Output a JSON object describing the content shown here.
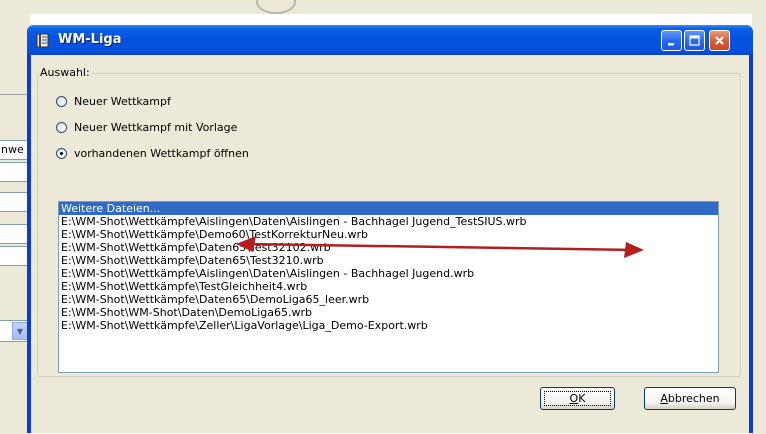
{
  "background": {
    "field_fragment": "nwe"
  },
  "window": {
    "title": "WM-Liga",
    "title_icon": "app-book-icon",
    "caption_buttons": [
      "minimize-icon",
      "maximize-icon",
      "close-icon"
    ]
  },
  "group": {
    "label": "Auswahl:",
    "options": [
      {
        "label": "Neuer Wettkampf",
        "checked": false
      },
      {
        "label": "Neuer Wettkampf mit Vorlage",
        "checked": false
      },
      {
        "label": "vorhandenen Wettkampf öffnen",
        "checked": true
      }
    ]
  },
  "files": {
    "items": [
      {
        "label": "Weitere Dateien...",
        "selected": true
      },
      {
        "label": "E:\\WM-Shot\\Wettkämpfe\\Aislingen\\Daten\\Aislingen - Bachhagel Jugend_TestSIUS.wrb",
        "selected": false
      },
      {
        "label": "E:\\WM-Shot\\Wettkämpfe\\Demo60\\TestKorrekturNeu.wrb",
        "selected": false
      },
      {
        "label": "E:\\WM-Shot\\Wettkämpfe\\Daten65\\Test32102.wrb",
        "selected": false
      },
      {
        "label": "E:\\WM-Shot\\Wettkämpfe\\Daten65\\Test3210.wrb",
        "selected": false
      },
      {
        "label": "E:\\WM-Shot\\Wettkämpfe\\Aislingen\\Daten\\Aislingen - Bachhagel Jugend.wrb",
        "selected": false
      },
      {
        "label": "E:\\WM-Shot\\Wettkämpfe\\TestGleichheit4.wrb",
        "selected": false
      },
      {
        "label": "E:\\WM-Shot\\Wettkämpfe\\Daten65\\DemoLiga65_leer.wrb",
        "selected": false
      },
      {
        "label": "E:\\WM-Shot\\WM-Shot\\Daten\\DemoLiga65.wrb",
        "selected": false
      },
      {
        "label": "E:\\WM-Shot\\Wettkämpfe\\Zeller\\LigaVorlage\\Liga_Demo-Export.wrb",
        "selected": false
      }
    ]
  },
  "annotation": {
    "color": "#b41e1e",
    "meaning": "double-arrow"
  },
  "buttons": {
    "ok": "OK",
    "cancel": "Abbrechen"
  },
  "colors": {
    "titlebar": "#0653e0",
    "selection": "#316ac5",
    "dialog_bg": "#ece9d8"
  }
}
